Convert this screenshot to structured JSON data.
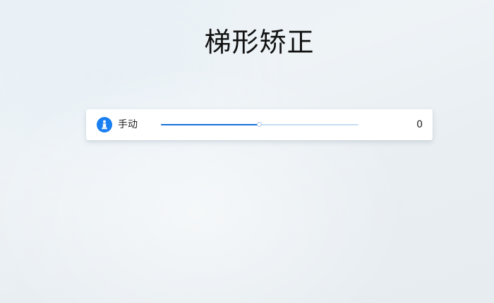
{
  "page": {
    "title": "梯形矫正"
  },
  "keystone": {
    "mode_label": "手动",
    "value_text": "0",
    "slider_fraction": 0.5,
    "accent_color": "#1570dc",
    "icon": "figure-icon"
  }
}
